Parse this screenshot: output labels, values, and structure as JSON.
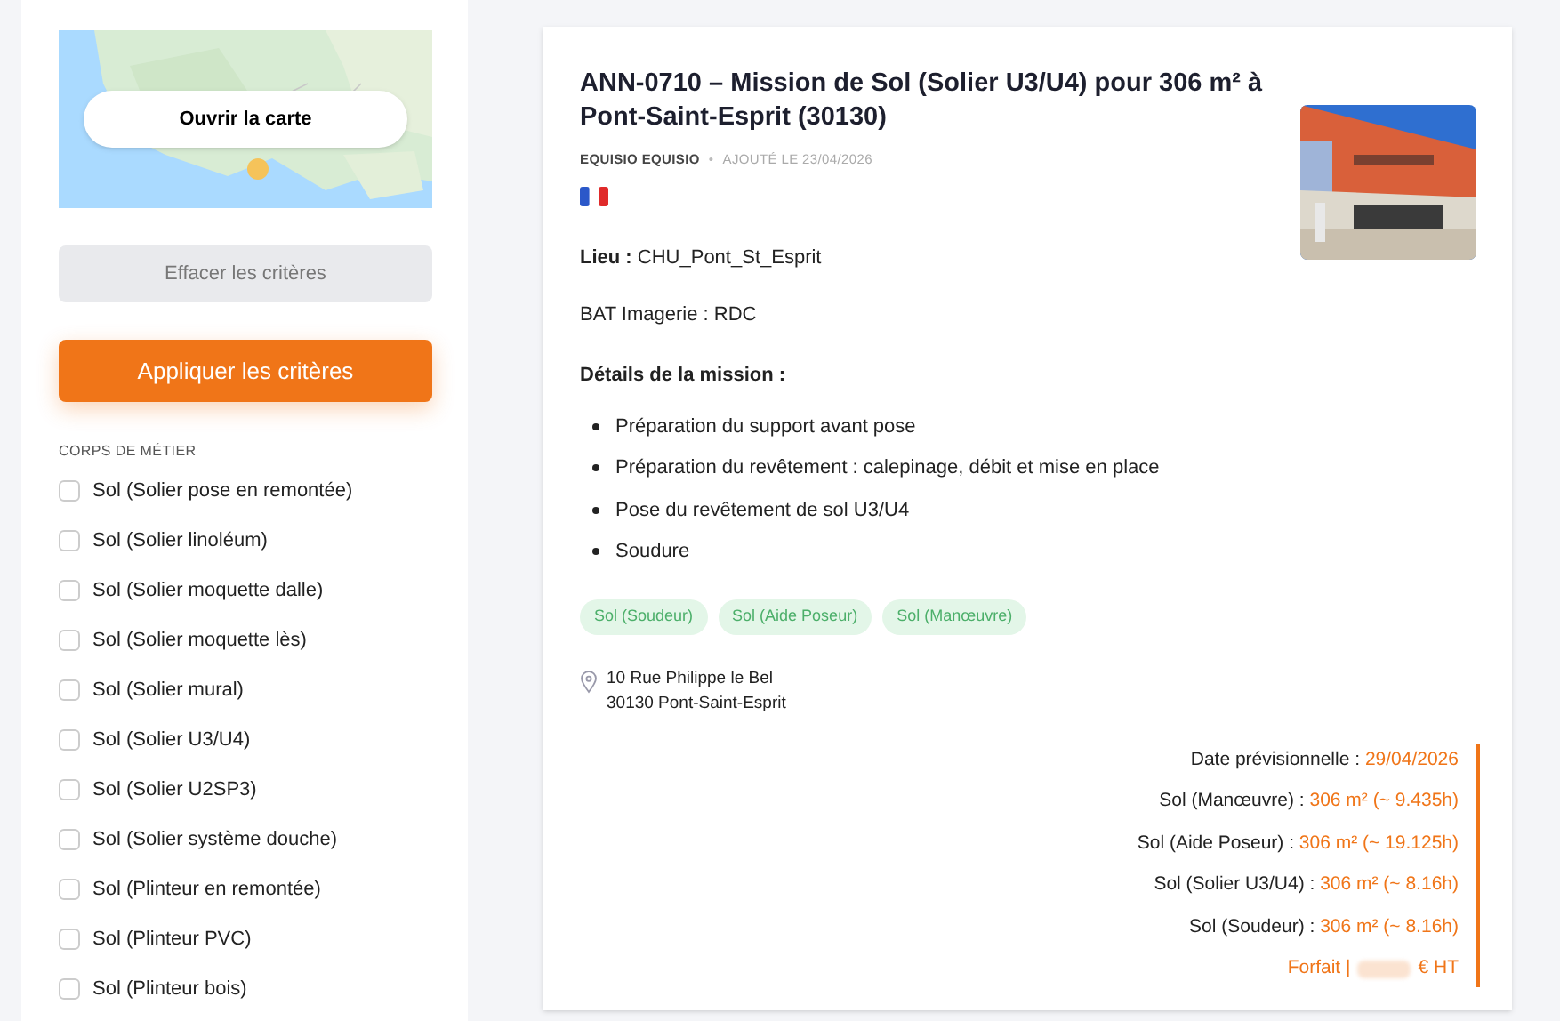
{
  "sidebar": {
    "map": {
      "kind": "picture",
      "button": "Ouvrir la carte"
    },
    "clear_button": "Effacer les critères",
    "apply_button": "Appliquer les critères",
    "filter_title": "CORPS DE MÉTIER",
    "filters": [
      {
        "label": "Sol (Solier pose en remontée)",
        "checked": false
      },
      {
        "label": "Sol (Solier linoléum)",
        "checked": false
      },
      {
        "label": "Sol (Solier moquette dalle)",
        "checked": false
      },
      {
        "label": "Sol (Solier moquette lès)",
        "checked": false
      },
      {
        "label": "Sol (Solier mural)",
        "checked": false
      },
      {
        "label": "Sol (Solier U3/U4)",
        "checked": false
      },
      {
        "label": "Sol (Solier U2SP3)",
        "checked": false
      },
      {
        "label": "Sol (Solier système douche)",
        "checked": false
      },
      {
        "label": "Sol (Plinteur en remontée)",
        "checked": false
      },
      {
        "label": "Sol (Plinteur PVC)",
        "checked": false
      },
      {
        "label": "Sol (Plinteur bois)",
        "checked": false
      }
    ]
  },
  "listing": {
    "title": "ANN-0710 – Mission de Sol (Solier U3/U4) pour 306 m² à Pont-Saint-Esprit (30130)",
    "author": "EQUISIO EQUISIO",
    "separator": "•",
    "added": "AJOUTÉ LE 23/04/2026",
    "image": {
      "kind": "picture"
    },
    "place_label": "Lieu :",
    "place": "CHU_Pont_St_Esprit",
    "building": "BAT Imagerie : RDC",
    "details_title": "Détails de la mission :",
    "tasks": [
      "Préparation du support avant pose",
      "Préparation du revêtement : calepinage, débit et mise en place",
      "Pose du revêtement de sol U3/U4",
      "Soudure"
    ],
    "tags": [
      "Sol (Soudeur)",
      "Sol (Aide Poseur)",
      "Sol (Manœuvre)"
    ],
    "address": [
      "10 Rue Philippe le Bel",
      "30130 Pont-Saint-Esprit"
    ],
    "summary": [
      {
        "label": "Date prévisionnelle :",
        "value": "29/04/2026"
      },
      {
        "label": "Sol (Manœuvre) :",
        "value": "306 m² (~ 9.435h)"
      },
      {
        "label": "Sol (Aide Poseur) :",
        "value": "306 m² (~ 19.125h)"
      },
      {
        "label": "Sol (Solier U3/U4) :",
        "value": "306 m² (~ 8.16h)"
      },
      {
        "label": "Sol (Soudeur) :",
        "value": "306 m² (~ 8.16h)"
      }
    ],
    "price": {
      "prefix": "Forfait |",
      "suffix": "€ HT",
      "hidden": true
    }
  }
}
